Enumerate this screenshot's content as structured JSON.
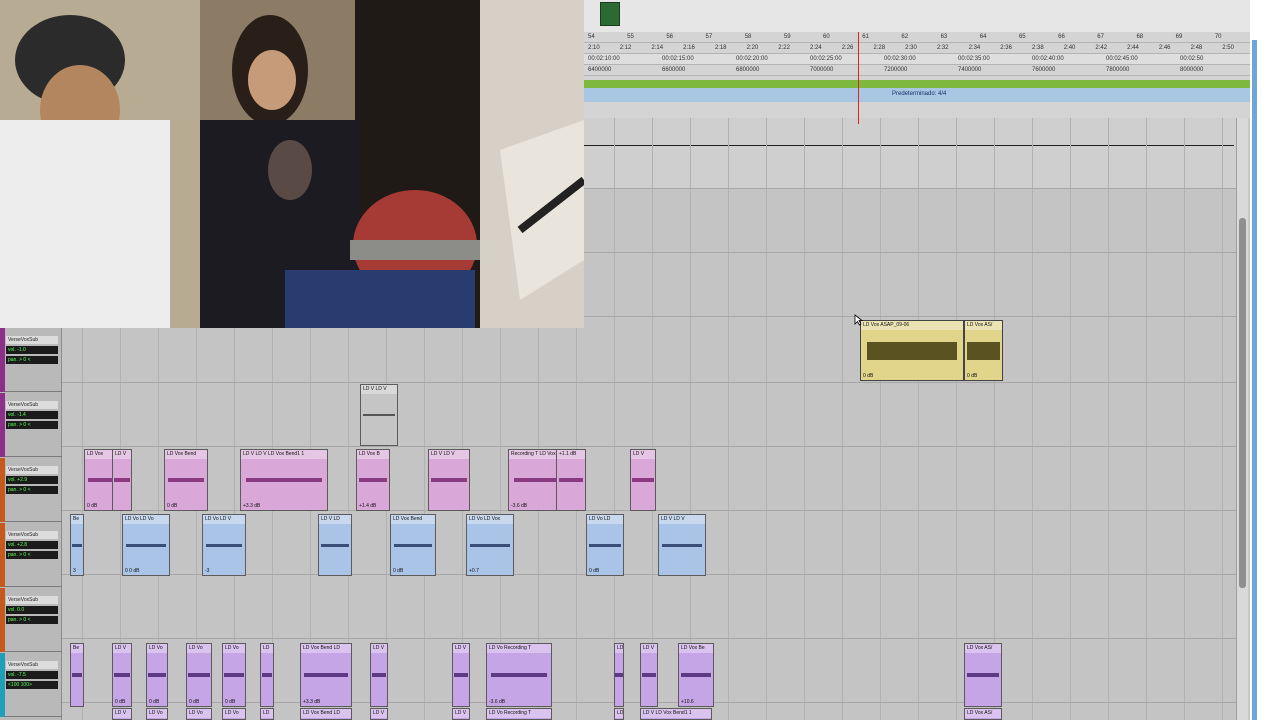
{
  "ruler": {
    "bars_beats": [
      "54",
      "55",
      "56",
      "57",
      "58",
      "59",
      "60",
      "61",
      "62",
      "63",
      "64",
      "65",
      "66",
      "67",
      "68",
      "69",
      "70"
    ],
    "min_secs": [
      "2:10",
      "2:12",
      "2:14",
      "2:16",
      "2:18",
      "2:20",
      "2:22",
      "2:24",
      "2:26",
      "2:28",
      "2:30",
      "2:32",
      "2:34",
      "2:36",
      "2:38",
      "2:40",
      "2:42",
      "2:44",
      "2:46",
      "2:48",
      "2:50"
    ],
    "timecode": [
      "00:02:10:00",
      "00:02:15:00",
      "00:02:20:00",
      "00:02:25:00",
      "00:02:30:00",
      "00:02:35:00",
      "00:02:40:00",
      "00:02:45:00",
      "00:02:50"
    ],
    "samples": [
      "6400000",
      "6600000",
      "6800000",
      "7000000",
      "7200000",
      "7400000",
      "7600000",
      "7800000",
      "8000000"
    ],
    "meter_label": "Predeterminado: 4/4"
  },
  "tracks": [
    {
      "name": "VerseVoxSub",
      "number": "4",
      "color": "#8b2f8b",
      "vol": "vol. -1.0",
      "pan": "pan. > 0 <"
    },
    {
      "name": "VerseVoxSub",
      "number": "4",
      "color": "#8b2f8b",
      "vol": "vol. -1.4",
      "pan": "pan. > 0 <"
    },
    {
      "name": "VerseVoxSub",
      "number": "4",
      "color": "#c55a1c",
      "vol": "vol. +2.9",
      "pan": "pan. > 0 <"
    },
    {
      "name": "VerseVoxSub",
      "number": "4",
      "color": "#c55a1c",
      "vol": "vol. +2.8",
      "pan": "pan. > 0 <"
    },
    {
      "name": "VerseVoxSub",
      "number": "4",
      "color": "#c55a1c",
      "vol": "vol. 0.0",
      "pan": "pan. > 0 <"
    },
    {
      "name": "VerseVoxSub",
      "number": "3",
      "color": "#1f9fb8",
      "vol": "vol. -7.5",
      "pan": "<100 100>"
    }
  ],
  "clips": {
    "yellow_main": {
      "name": "LD Vox ASAP_09-06",
      "name2": "LD Vox AS/",
      "gain": "0 dB",
      "gain2": "0 dB"
    },
    "gray_small": {
      "name": "LD V LD V"
    },
    "pink_row": [
      {
        "name": "LD Vox",
        "gain": "0 dB"
      },
      {
        "name": "LD V"
      },
      {
        "name": "LD Vox Bend",
        "gain": "0 dB"
      },
      {
        "name": "LD V LD V LD Vox Bend1 1",
        "gain": "+3.3 dB"
      },
      {
        "name": "LD Vox B",
        "gain": "+1.4 dB"
      },
      {
        "name": "LD V LD V"
      },
      {
        "name": "Recording T LD Vox B",
        "gain": "-3.6 dB"
      },
      {
        "name": "+1.1 dB"
      },
      {
        "name": "LD V"
      }
    ],
    "blue_row": [
      {
        "name": "Be",
        "gain": "3"
      },
      {
        "name": "LD Vo LD Vo",
        "gain": "0 0 dB"
      },
      {
        "name": "LD Vo LD V",
        "gain": "-3"
      },
      {
        "name": "LD V LD",
        "gain": ""
      },
      {
        "name": "LD Vox Bend",
        "gain": "0 dB"
      },
      {
        "name": "LD Vo LD Vox",
        "gain": "+0.7"
      },
      {
        "name": "LD Vo LD",
        "gain": "0 dB"
      },
      {
        "name": "LD V LD V",
        "gain": ""
      }
    ],
    "violet_row": [
      {
        "name": "Be"
      },
      {
        "name": "LD V",
        "gain": "0 dB"
      },
      {
        "name": "LD Vo",
        "gain": "0 dB"
      },
      {
        "name": "LD Vo",
        "gain": "0 dB"
      },
      {
        "name": "LD Vo",
        "gain": "0 dB"
      },
      {
        "name": "LD"
      },
      {
        "name": "LD Vox Bend LD",
        "gain": "+3.3 dB"
      },
      {
        "name": "LD V"
      },
      {
        "name": "LD V"
      },
      {
        "name": "LD Vo Recording T",
        "gain": "-3.6 dB"
      },
      {
        "name": "LD"
      },
      {
        "name": "LD V"
      },
      {
        "name": "LD Vox Be",
        "gain": "+10.6"
      },
      {
        "name": "LD Vox AS/"
      }
    ],
    "bottom_row": [
      "LD V",
      "LD Vo",
      "LD Vo",
      "LD Vo",
      "LD",
      "LD Vox Bend LD",
      "LD V",
      "LD V",
      "LD Vo Recording T",
      "LD",
      "LD V LD Vox Bend1 1",
      "LD Vox AS/"
    ]
  },
  "colors": {
    "tempo": "#7fb83f",
    "meter": "#a9c6e3",
    "playhead": "#d22222",
    "clip_pink": "#d9a8d8",
    "clip_blue": "#a9c4e6",
    "clip_violet": "#c6a5e6",
    "clip_yellow": "#e0d58a"
  },
  "icons": [
    "pointer-cursor-icon",
    "scroll-up-icon",
    "scroll-down-icon"
  ]
}
